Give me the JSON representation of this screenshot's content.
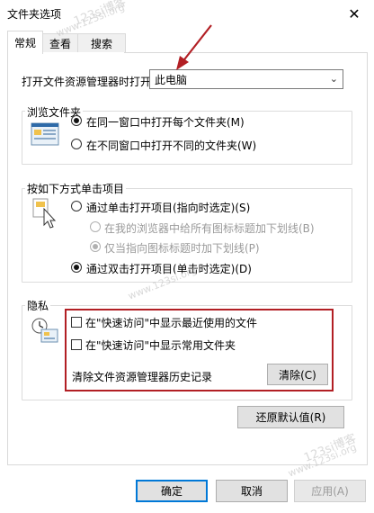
{
  "window": {
    "title": "文件夹选项",
    "close_glyph": "✕"
  },
  "tabs": [
    {
      "label": "常规",
      "active": true
    },
    {
      "label": "查看",
      "active": false
    },
    {
      "label": "搜索",
      "active": false
    }
  ],
  "open_explorer": {
    "label": "打开文件资源管理器时打开:",
    "value": "此电脑"
  },
  "browse": {
    "group_title": "浏览文件夹",
    "options": [
      {
        "label": "在同一窗口中打开每个文件夹(M)",
        "checked": true
      },
      {
        "label": "在不同窗口中打开不同的文件夹(W)",
        "checked": false
      }
    ]
  },
  "click": {
    "group_title": "按如下方式单击项目",
    "single_click": {
      "label": "通过单击打开项目(指向时选定)(S)",
      "checked": false
    },
    "underline_all": {
      "label": "在我的浏览器中给所有图标标题加下划线(B)",
      "checked": false
    },
    "underline_point": {
      "label": "仅当指向图标标题时加下划线(P)",
      "checked": true
    },
    "double_click": {
      "label": "通过双击打开项目(单击时选定)(D)",
      "checked": true
    }
  },
  "privacy": {
    "group_title": "隐私",
    "show_recent_files": "在\"快速访问\"中显示最近使用的文件",
    "show_frequent_folders": "在\"快速访问\"中显示常用文件夹",
    "clear_history_label": "清除文件资源管理器历史记录",
    "clear_button": "清除(C)"
  },
  "restore_defaults_button": "还原默认值(R)",
  "footer": {
    "ok": "确定",
    "cancel": "取消",
    "apply": "应用(A)"
  },
  "watermarks": {
    "top": "123si博客",
    "top_url": "www.123si.org",
    "middle_url": "www.123si.org",
    "bottom": "123si博客",
    "bottom_url": "www.123si.org"
  },
  "colors": {
    "annotation_red": "#b21f24",
    "accent_blue": "#0078d7"
  }
}
